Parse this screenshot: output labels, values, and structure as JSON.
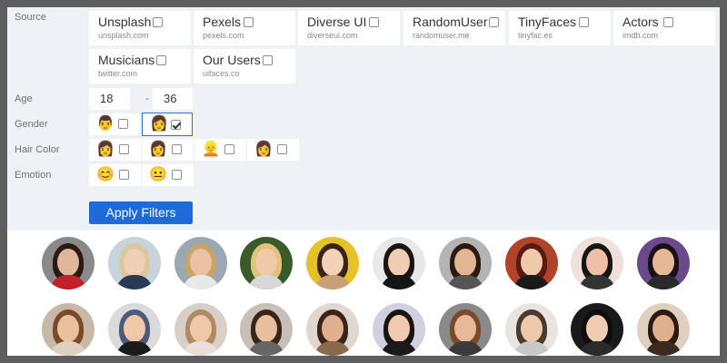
{
  "labels": {
    "source": "Source",
    "age": "Age",
    "gender": "Gender",
    "hair_color": "Hair Color",
    "emotion": "Emotion"
  },
  "sources": [
    {
      "name": "Unsplash",
      "domain": "unsplash.com",
      "checked": false
    },
    {
      "name": "Pexels",
      "domain": "pexels.com",
      "checked": false
    },
    {
      "name": "Diverse UI",
      "domain": "diverseui.com",
      "checked": false
    },
    {
      "name": "RandomUser",
      "domain": "randomuser.me",
      "checked": false
    },
    {
      "name": "TinyFaces",
      "domain": "tinyfac.es",
      "checked": false
    },
    {
      "name": "Actors",
      "domain": "imdb.com",
      "checked": false
    },
    {
      "name": "Musicians",
      "domain": "twitter.com",
      "checked": false
    },
    {
      "name": "Our Users",
      "domain": "uifaces.co",
      "checked": false
    }
  ],
  "age": {
    "min": "18",
    "separator": "-",
    "max": "36"
  },
  "gender": [
    {
      "icon": "male-icon",
      "glyph": "👨",
      "checked": false,
      "selected": false
    },
    {
      "icon": "female-icon",
      "glyph": "👩",
      "checked": true,
      "selected": true
    }
  ],
  "hair_color": [
    {
      "icon": "black-hair-icon",
      "glyph": "👩",
      "checked": false
    },
    {
      "icon": "brown-hair-icon",
      "glyph": "👩",
      "checked": false
    },
    {
      "icon": "blond-hair-icon",
      "glyph": "👱",
      "checked": false
    },
    {
      "icon": "red-hair-icon",
      "glyph": "👩",
      "checked": false
    }
  ],
  "emotion": [
    {
      "icon": "happy-icon",
      "glyph": "😊",
      "checked": false
    },
    {
      "icon": "neutral-icon",
      "glyph": "😐",
      "checked": false
    }
  ],
  "apply_button": "Apply Filters",
  "accent_color": "#1c6bd8",
  "avatars": [
    {
      "bg": "#8a8a8a",
      "skin": "#e0b79a",
      "hair": "#2a1a12",
      "shirt": "#c0202a"
    },
    {
      "bg": "#c8d3dc",
      "skin": "#f0cfb4",
      "hair": "#d9c7a0",
      "shirt": "#2a3a55"
    },
    {
      "bg": "#9aa8b4",
      "skin": "#eac3a5",
      "hair": "#c9a46a",
      "shirt": "#e8e8e8"
    },
    {
      "bg": "#3a5a2a",
      "skin": "#f2c9a8",
      "hair": "#e2c27a",
      "shirt": "#d8d8d8"
    },
    {
      "bg": "#e6c22a",
      "skin": "#f3d2b8",
      "hair": "#3a2418",
      "shirt": "#c8a07a"
    },
    {
      "bg": "#e8e8e8",
      "skin": "#f0cdb2",
      "hair": "#1c1410",
      "shirt": "#151515"
    },
    {
      "bg": "#b4b4b4",
      "skin": "#e2b593",
      "hair": "#2a1a12",
      "shirt": "#555555"
    },
    {
      "bg": "#b0442a",
      "skin": "#f0c8aa",
      "hair": "#5a1a10",
      "shirt": "#1a1a1a"
    },
    {
      "bg": "#f0e0dc",
      "skin": "#eec0a6",
      "hair": "#151515",
      "shirt": "#333333"
    },
    {
      "bg": "#6a4a8a",
      "skin": "#e6b898",
      "hair": "#1a1018",
      "shirt": "#2a2a2a"
    },
    {
      "bg": "#c8b8a8",
      "skin": "#eac0a0",
      "hair": "#7a4a2a",
      "shirt": "#e0d0c0"
    },
    {
      "bg": "#dadada",
      "skin": "#f0c8a8",
      "hair": "#4a5a7a",
      "shirt": "#1a1a1a"
    },
    {
      "bg": "#d8d0c8",
      "skin": "#eec8aa",
      "hair": "#b08a62",
      "shirt": "#e8e0d8"
    },
    {
      "bg": "#c8c0b8",
      "skin": "#e8c0a0",
      "hair": "#3a2418",
      "shirt": "#666666"
    },
    {
      "bg": "#e0d8d0",
      "skin": "#e0b090",
      "hair": "#3a2418",
      "shirt": "#8a6a4a"
    },
    {
      "bg": "#d0d0e0",
      "skin": "#f0cab0",
      "hair": "#1a1410",
      "shirt": "#1a1a1a"
    },
    {
      "bg": "#8a8a8a",
      "skin": "#e8b898",
      "hair": "#7a4a2a",
      "shirt": "#3a3a3a"
    },
    {
      "bg": "#e8e4e0",
      "skin": "#eec8ac",
      "hair": "#4a3a30",
      "shirt": "#c8c8c8"
    },
    {
      "bg": "#1a1a1a",
      "skin": "#f0cdb0",
      "hair": "#0e0e0e",
      "shirt": "#2a2a2a"
    },
    {
      "bg": "#e0d0c0",
      "skin": "#e0b090",
      "hair": "#2a1a12",
      "shirt": "#3a2a20"
    }
  ]
}
